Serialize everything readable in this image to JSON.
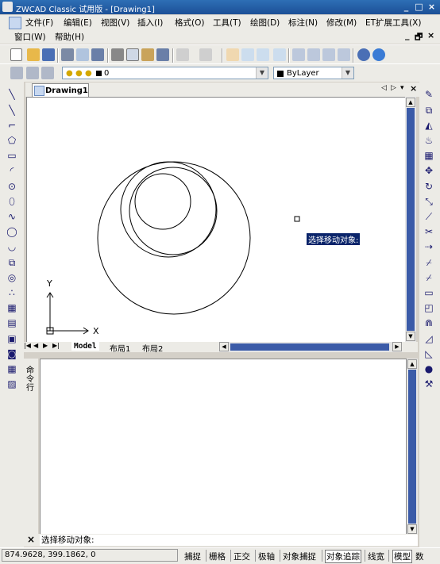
{
  "window": {
    "title": "ZWCAD Classic 试用版 - [Drawing1]",
    "controls": [
      "_",
      "□",
      "×"
    ]
  },
  "menu": {
    "row1": [
      "文件(F)",
      "编辑(E)",
      "视图(V)",
      "插入(I)",
      "格式(O)",
      "工具(T)",
      "绘图(D)",
      "标注(N)",
      "修改(M)",
      "ET扩展工具(X)"
    ],
    "row2": [
      "窗口(W)",
      "帮助(H)"
    ],
    "mdi_controls": [
      "_",
      "🗗",
      "×"
    ]
  },
  "layer_combo": {
    "value": "0"
  },
  "color_combo": {
    "value": "ByLayer"
  },
  "drawing": {
    "tab_label": "Drawing1",
    "tab_nav": [
      "◁",
      "▷",
      "▾",
      "×"
    ],
    "tooltip": "选择移动对象:",
    "axis_x": "X",
    "axis_y": "Y"
  },
  "layout_tabs": [
    "Model",
    "布局1",
    "布局2"
  ],
  "command": {
    "panel_label": "命令行",
    "prompt": "选择移动对象:",
    "close": "×"
  },
  "status": {
    "coords": "874.9628,  399.1862,  0",
    "toggles": [
      "捕捉",
      "栅格",
      "正交",
      "极轴",
      "对象捕捉",
      "对象追踪",
      "线宽",
      "模型",
      "数"
    ]
  },
  "colors": {
    "accent": "#2e6fb5",
    "scroll_thumb": "#3b5ba8",
    "tooltip_bg": "#0a246a"
  }
}
